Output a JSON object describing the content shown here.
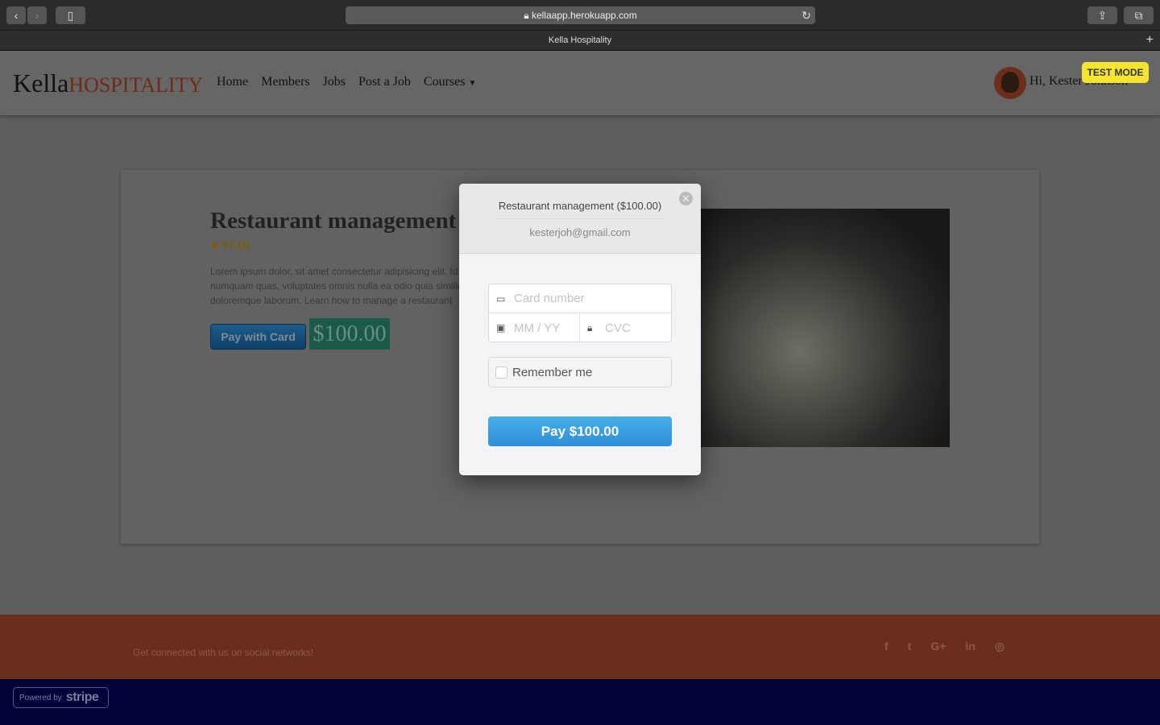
{
  "browser": {
    "url": "kellaapp.herokuapp.com",
    "tab_title": "Kella Hospitality"
  },
  "header": {
    "logo_main": "Kella",
    "logo_accent": "HOSPITALITY",
    "nav": [
      "Home",
      "Members",
      "Jobs",
      "Post a Job",
      "Courses"
    ],
    "greeting": "Hi, Kester Johnson",
    "test_mode": "TEST MODE"
  },
  "course": {
    "title": "Restaurant management",
    "rating": "5.0 (1)",
    "description": [
      "Lorem ipsum dolor, sit amet consectetur adipisicing elit. Id",
      "numquam quas, voluptates omnis nulla ea odio quia similiq",
      "doloremque laborum. Learn how to manage a restaurant"
    ],
    "pay_button": "Pay with Card",
    "price": "$100.00"
  },
  "checkout": {
    "title": "Restaurant management ($100.00)",
    "email": "kesterjoh@gmail.com",
    "card_placeholder": "Card number",
    "expiry_placeholder": "MM / YY",
    "cvc_placeholder": "CVC",
    "remember_label": "Remember me",
    "pay_label": "Pay $100.00"
  },
  "footer": {
    "text": "Get connected with us on social networks!",
    "social": [
      "facebook-icon",
      "twitter-icon",
      "google-plus-icon",
      "linkedin-icon",
      "instagram-icon"
    ],
    "stripe_powered": "Powered by",
    "stripe_brand": "stripe"
  },
  "colors": {
    "accent": "#6e2b18",
    "pay": "#3a9fe0",
    "test_mode": "#f5e430",
    "footer": "#6b2e1c"
  }
}
